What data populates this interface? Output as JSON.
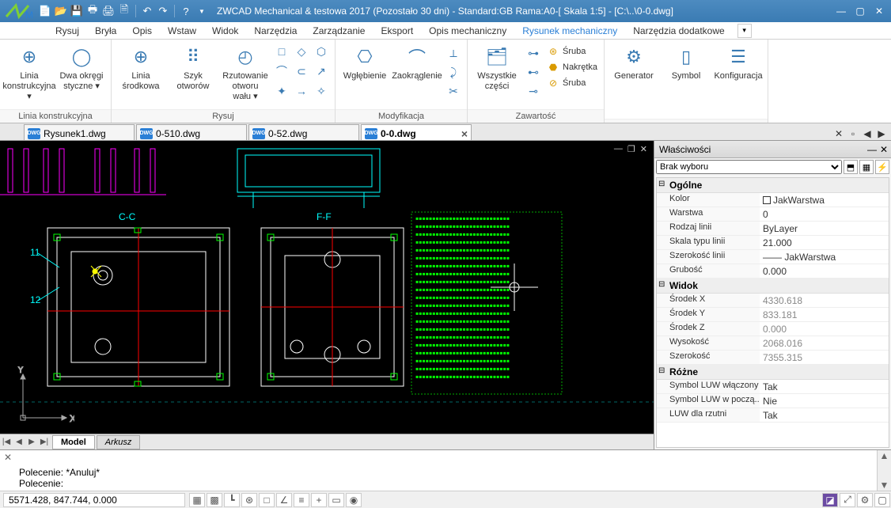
{
  "title": "ZWCAD Mechanical & testowa 2017 (Pozostało 30 dni) -  Standard:GB Rama:A0-[ Skala 1:5] - [C:\\..\\0-0.dwg]",
  "menus": [
    "Rysuj",
    "Bryła",
    "Opis",
    "Wstaw",
    "Widok",
    "Narzędzia",
    "Zarządzanie",
    "Eksport",
    "Opis mechaniczny",
    "Rysunek mechaniczny",
    "Narzędzia dodatkowe"
  ],
  "menu_active": 9,
  "ribbon": {
    "groups": [
      {
        "label": "Linia konstrukcyjna",
        "buttons": [
          {
            "label": "Linia konstrukcyjna ▾",
            "icon": "⊕"
          },
          {
            "label": "Dwa okręgi styczne ▾",
            "icon": "◯"
          }
        ]
      },
      {
        "label": "Rysuj",
        "buttons": [
          {
            "label": "Linia środkowa",
            "icon": "⊕"
          },
          {
            "label": "Szyk otworów",
            "icon": "⠿"
          },
          {
            "label": "Rzutowanie otworu wału ▾",
            "icon": "◴"
          }
        ],
        "smallgrid": [
          "□",
          "◇",
          "⬡",
          "⌒",
          "⊂",
          "↗",
          "✦",
          "→",
          "✧"
        ]
      },
      {
        "label": "Modyfikacja",
        "buttons": [
          {
            "label": "Wgłębienie",
            "icon": "⎔"
          },
          {
            "label": "Zaokrąglenie",
            "icon": "⌒"
          }
        ],
        "smallcol": [
          "⟂",
          "⤸",
          "✂"
        ]
      },
      {
        "label": "Zawartość",
        "buttons": [
          {
            "label": "Wszystkie części",
            "icon": "🗂"
          }
        ],
        "stack": [
          {
            "icon": "⊛",
            "label": "Śruba"
          },
          {
            "icon": "⬣",
            "label": "Nakrętka"
          },
          {
            "icon": "⊘",
            "label": "Śruba"
          }
        ],
        "smallcol": [
          "⊶",
          "⊷",
          "⊸"
        ]
      },
      {
        "label": "",
        "buttons": [
          {
            "label": "Generator",
            "icon": "⚙"
          },
          {
            "label": "Symbol",
            "icon": "▯"
          },
          {
            "label": "Konfiguracja",
            "icon": "☰"
          }
        ]
      }
    ]
  },
  "tabs": [
    {
      "label": "Rysunek1.dwg",
      "active": false
    },
    {
      "label": "0-510.dwg",
      "active": false
    },
    {
      "label": "0-52.dwg",
      "active": false
    },
    {
      "label": "0-0.dwg",
      "active": true
    }
  ],
  "modeltabs": [
    {
      "label": "Model",
      "active": true
    },
    {
      "label": "Arkusz",
      "active": false
    }
  ],
  "canvas_labels": {
    "cc": "C-C",
    "ff": "F-F",
    "a": "11",
    "b": "12"
  },
  "properties": {
    "title": "Właściwości",
    "selection": "Brak wyboru",
    "sections": [
      {
        "name": "Ogólne",
        "rows": [
          {
            "k": "Kolor",
            "v": "JakWarstwa",
            "color": true
          },
          {
            "k": "Warstwa",
            "v": "0"
          },
          {
            "k": "Rodzaj linii",
            "v": "ByLayer",
            "line": true
          },
          {
            "k": "Skala typu linii",
            "v": "21.000"
          },
          {
            "k": "Szerokość linii",
            "v": "—— JakWarstwa"
          },
          {
            "k": "Grubość",
            "v": "0.000"
          }
        ]
      },
      {
        "name": "Widok",
        "rows": [
          {
            "k": "Środek X",
            "v": "4330.618",
            "muted": true
          },
          {
            "k": "Środek Y",
            "v": "833.181",
            "muted": true
          },
          {
            "k": "Środek Z",
            "v": "0.000",
            "muted": true
          },
          {
            "k": "Wysokość",
            "v": "2068.016",
            "muted": true
          },
          {
            "k": "Szerokość",
            "v": "7355.315",
            "muted": true
          }
        ]
      },
      {
        "name": "Różne",
        "rows": [
          {
            "k": "Symbol LUW włączony",
            "v": "Tak"
          },
          {
            "k": "Symbol LUW w począ...",
            "v": "Nie"
          },
          {
            "k": "LUW dla rzutni",
            "v": "Tak"
          }
        ]
      }
    ]
  },
  "cmd": {
    "lines": [
      "Polecenie: *Anuluj*",
      "Polecenie: "
    ]
  },
  "status": {
    "coords": "5571.428, 847.744, 0.000"
  }
}
